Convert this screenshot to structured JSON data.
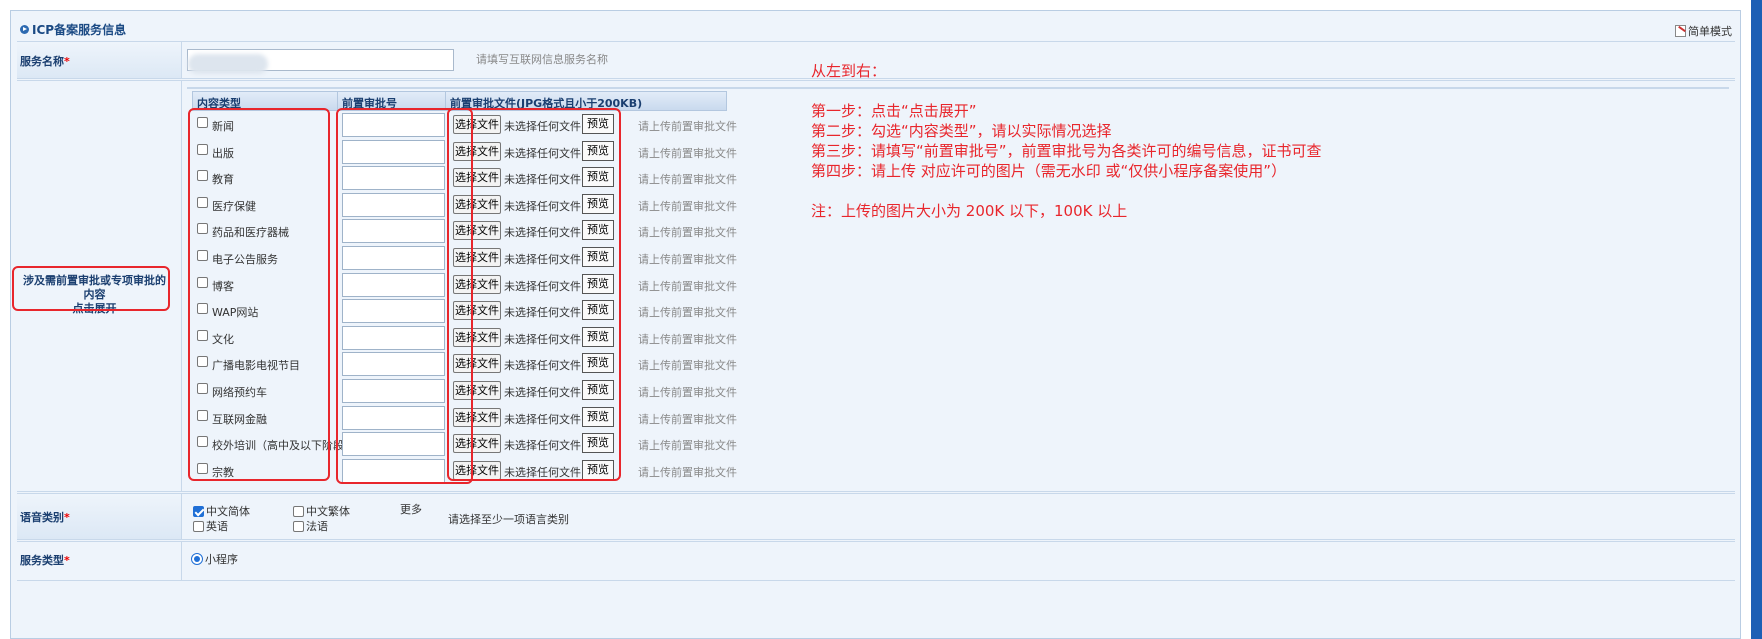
{
  "panel": {
    "title": "ICP备案服务信息",
    "mode_switch": "简单模式"
  },
  "service_name": {
    "label": "服务名称",
    "required_mark": "*",
    "value": "",
    "hint": "请填写互联网信息服务名称"
  },
  "approval": {
    "label_line1": "涉及需前置审批或专项审批的内容",
    "label_line2": "点击展开",
    "columns": [
      "内容类型",
      "前置审批号",
      "前置审批文件(JPG格式且小于200KB)"
    ],
    "choose_file_label": "选择文件",
    "no_file_label": "未选择任何文件",
    "preview_label": "预览",
    "upload_hint": "请上传前置审批文件",
    "items": [
      {
        "label": "新闻",
        "checked": false
      },
      {
        "label": "出版",
        "checked": false
      },
      {
        "label": "教育",
        "checked": false
      },
      {
        "label": "医疗保健",
        "checked": false
      },
      {
        "label": "药品和医疗器械",
        "checked": false
      },
      {
        "label": "电子公告服务",
        "checked": false
      },
      {
        "label": "博客",
        "checked": false
      },
      {
        "label": "WAP网站",
        "checked": false
      },
      {
        "label": "文化",
        "checked": false
      },
      {
        "label": "广播电影电视节目",
        "checked": false
      },
      {
        "label": "网络预约车",
        "checked": false
      },
      {
        "label": "互联网金融",
        "checked": false
      },
      {
        "label": "校外培训（高中及以下阶段）",
        "checked": false
      },
      {
        "label": "宗教",
        "checked": false
      }
    ]
  },
  "notes": {
    "text": "从左到右：\n\n第一步：点击“点击展开”\n第二步：勾选“内容类型”，请以实际情况选择\n第三步：请填写“前置审批号”，前置审批号为各类许可的编号信息，证书可查\n第四步：请上传 对应许可的图片（需无水印 或“仅供小程序备案使用”）\n\n注：上传的图片大小为 200K 以下，100K 以上"
  },
  "language": {
    "label": "语音类别",
    "required_mark": "*",
    "options": [
      {
        "label": "中文简体",
        "checked": true
      },
      {
        "label": "中文繁体",
        "checked": false
      },
      {
        "label": "英语",
        "checked": false
      },
      {
        "label": "法语",
        "checked": false
      }
    ],
    "more": "更多",
    "hint": "请选择至少一项语言类别"
  },
  "service_type": {
    "label": "服务类型",
    "required_mark": "*",
    "option": "小程序",
    "selected": true
  },
  "colors": {
    "annotation_red": "#e8262c",
    "header_blue": "#1b4a84",
    "panel_bg": "#eef4fb"
  }
}
